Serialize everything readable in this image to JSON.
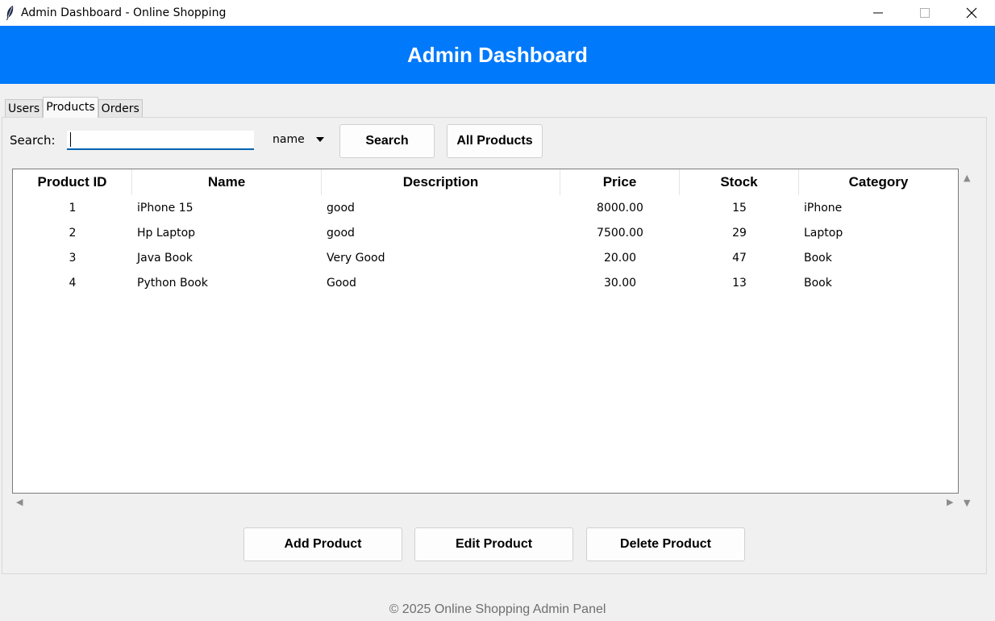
{
  "window": {
    "title": "Admin Dashboard - Online Shopping",
    "icon": "feather-icon"
  },
  "header": {
    "title": "Admin Dashboard",
    "background": "#0079fb"
  },
  "tabs": [
    {
      "label": "Users",
      "active": false
    },
    {
      "label": "Products",
      "active": true
    },
    {
      "label": "Orders",
      "active": false
    }
  ],
  "search": {
    "label": "Search:",
    "value": "",
    "field": "name",
    "search_button": "Search",
    "all_button": "All Products"
  },
  "table": {
    "columns": [
      "Product ID",
      "Name",
      "Description",
      "Price",
      "Stock",
      "Category"
    ],
    "rows": [
      [
        "1",
        "iPhone 15",
        "good",
        "8000.00",
        "15",
        "iPhone"
      ],
      [
        "2",
        "Hp Laptop",
        "good",
        "7500.00",
        "29",
        "Laptop"
      ],
      [
        "3",
        "Java Book",
        "Very Good",
        "20.00",
        "47",
        "Book"
      ],
      [
        "4",
        "Python Book",
        "Good",
        "30.00",
        "13",
        "Book"
      ]
    ]
  },
  "actions": {
    "add": "Add Product",
    "edit": "Edit Product",
    "delete": "Delete Product"
  },
  "footer": {
    "text": "© 2025 Online Shopping Admin Panel"
  }
}
